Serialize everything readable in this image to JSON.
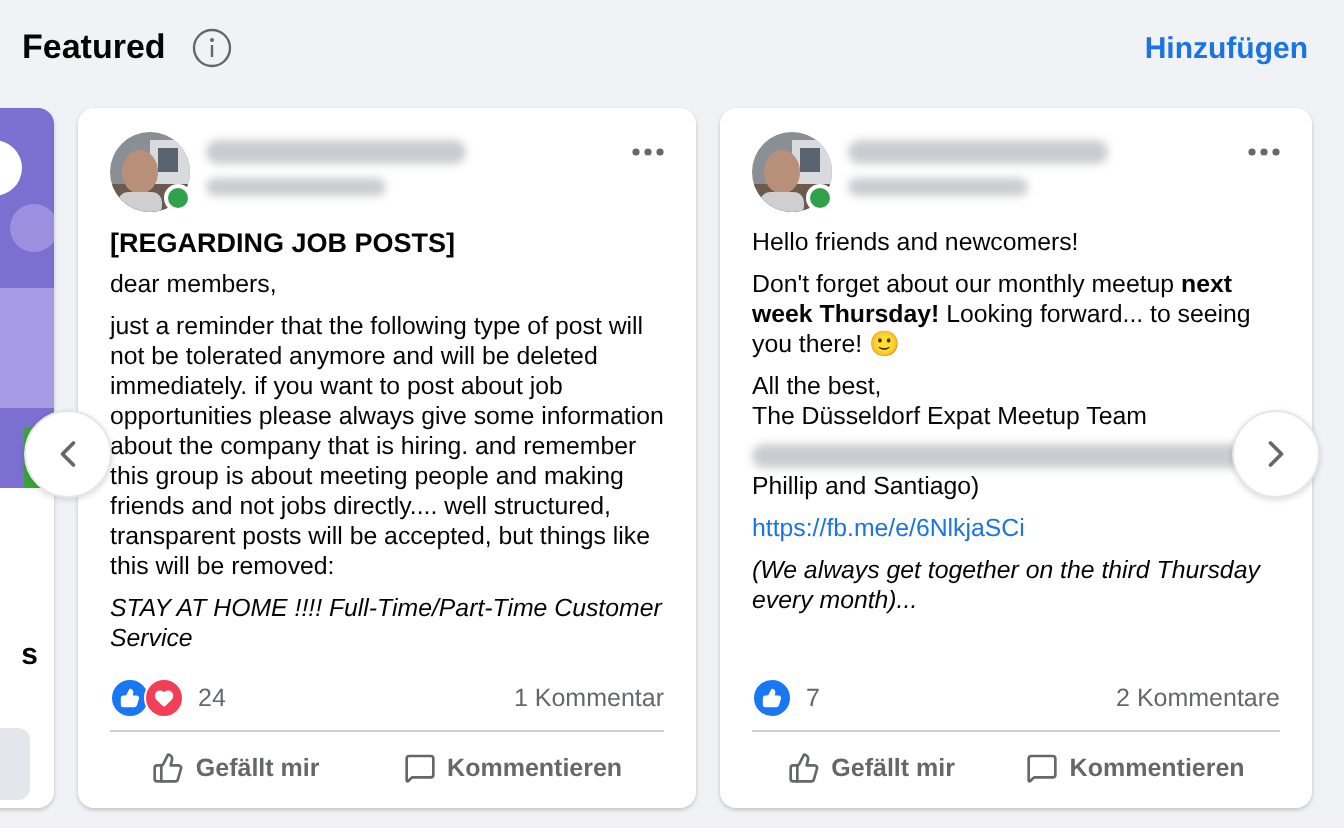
{
  "header": {
    "title": "Featured",
    "action": "Hinzufügen"
  },
  "partial_card": {
    "text": "s"
  },
  "posts": [
    {
      "online": true,
      "paragraphs": [
        {
          "kind": "heading",
          "text": "[REGARDING JOB POSTS]"
        },
        {
          "kind": "text",
          "text": "dear members,"
        },
        {
          "kind": "text",
          "text": "just a reminder that the following type of post will not be tolerated anymore and will be deleted immediately. if you want to post about job opportunities please always give some information about the company that is hiring. and remember this group is about meeting people and making friends and not jobs directly.... well structured, transparent posts will be accepted, but things like this will be removed:"
        },
        {
          "kind": "italic",
          "text": "STAY AT HOME !!!! Full-Time/Part-Time Customer Service"
        }
      ],
      "reactions": [
        {
          "kind": "like"
        },
        {
          "kind": "love"
        }
      ],
      "count": "24",
      "comments": "1 Kommentar",
      "actions": [
        "Gefällt mir",
        "Kommentieren"
      ]
    },
    {
      "online": true,
      "paragraphs": [
        {
          "kind": "text",
          "text": "Hello friends and newcomers!"
        },
        {
          "kind": "text",
          "text": "Don't forget about our monthly meetup **next week Thursday!** Looking forward... to seeing you there! 🙂"
        },
        {
          "kind": "lines",
          "lines": [
            "All the best,",
            "The Düsseldorf Expat Meetup Team"
          ]
        },
        {
          "kind": "blurred",
          "text": "Phillip and Santiago)"
        },
        {
          "kind": "link",
          "text": "https://fb.me/e/6NlkjaSCi"
        },
        {
          "kind": "italic",
          "text": "(We always get together on the third Thursday every month)..."
        }
      ],
      "reactions": [
        {
          "kind": "like"
        }
      ],
      "count": "7",
      "comments": "2 Kommentare",
      "actions": [
        "Gefällt mir",
        "Kommentieren"
      ]
    }
  ]
}
